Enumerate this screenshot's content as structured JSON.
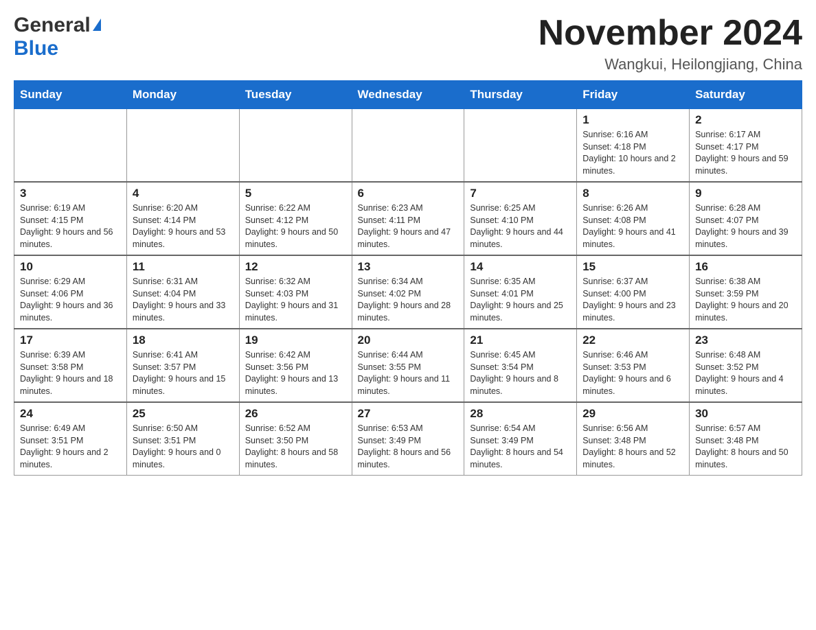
{
  "logo": {
    "general": "General",
    "blue": "Blue",
    "triangle": "▲"
  },
  "header": {
    "title": "November 2024",
    "location": "Wangkui, Heilongjiang, China"
  },
  "weekdays": [
    "Sunday",
    "Monday",
    "Tuesday",
    "Wednesday",
    "Thursday",
    "Friday",
    "Saturday"
  ],
  "weeks": [
    [
      {
        "day": "",
        "info": ""
      },
      {
        "day": "",
        "info": ""
      },
      {
        "day": "",
        "info": ""
      },
      {
        "day": "",
        "info": ""
      },
      {
        "day": "",
        "info": ""
      },
      {
        "day": "1",
        "info": "Sunrise: 6:16 AM\nSunset: 4:18 PM\nDaylight: 10 hours and 2 minutes."
      },
      {
        "day": "2",
        "info": "Sunrise: 6:17 AM\nSunset: 4:17 PM\nDaylight: 9 hours and 59 minutes."
      }
    ],
    [
      {
        "day": "3",
        "info": "Sunrise: 6:19 AM\nSunset: 4:15 PM\nDaylight: 9 hours and 56 minutes."
      },
      {
        "day": "4",
        "info": "Sunrise: 6:20 AM\nSunset: 4:14 PM\nDaylight: 9 hours and 53 minutes."
      },
      {
        "day": "5",
        "info": "Sunrise: 6:22 AM\nSunset: 4:12 PM\nDaylight: 9 hours and 50 minutes."
      },
      {
        "day": "6",
        "info": "Sunrise: 6:23 AM\nSunset: 4:11 PM\nDaylight: 9 hours and 47 minutes."
      },
      {
        "day": "7",
        "info": "Sunrise: 6:25 AM\nSunset: 4:10 PM\nDaylight: 9 hours and 44 minutes."
      },
      {
        "day": "8",
        "info": "Sunrise: 6:26 AM\nSunset: 4:08 PM\nDaylight: 9 hours and 41 minutes."
      },
      {
        "day": "9",
        "info": "Sunrise: 6:28 AM\nSunset: 4:07 PM\nDaylight: 9 hours and 39 minutes."
      }
    ],
    [
      {
        "day": "10",
        "info": "Sunrise: 6:29 AM\nSunset: 4:06 PM\nDaylight: 9 hours and 36 minutes."
      },
      {
        "day": "11",
        "info": "Sunrise: 6:31 AM\nSunset: 4:04 PM\nDaylight: 9 hours and 33 minutes."
      },
      {
        "day": "12",
        "info": "Sunrise: 6:32 AM\nSunset: 4:03 PM\nDaylight: 9 hours and 31 minutes."
      },
      {
        "day": "13",
        "info": "Sunrise: 6:34 AM\nSunset: 4:02 PM\nDaylight: 9 hours and 28 minutes."
      },
      {
        "day": "14",
        "info": "Sunrise: 6:35 AM\nSunset: 4:01 PM\nDaylight: 9 hours and 25 minutes."
      },
      {
        "day": "15",
        "info": "Sunrise: 6:37 AM\nSunset: 4:00 PM\nDaylight: 9 hours and 23 minutes."
      },
      {
        "day": "16",
        "info": "Sunrise: 6:38 AM\nSunset: 3:59 PM\nDaylight: 9 hours and 20 minutes."
      }
    ],
    [
      {
        "day": "17",
        "info": "Sunrise: 6:39 AM\nSunset: 3:58 PM\nDaylight: 9 hours and 18 minutes."
      },
      {
        "day": "18",
        "info": "Sunrise: 6:41 AM\nSunset: 3:57 PM\nDaylight: 9 hours and 15 minutes."
      },
      {
        "day": "19",
        "info": "Sunrise: 6:42 AM\nSunset: 3:56 PM\nDaylight: 9 hours and 13 minutes."
      },
      {
        "day": "20",
        "info": "Sunrise: 6:44 AM\nSunset: 3:55 PM\nDaylight: 9 hours and 11 minutes."
      },
      {
        "day": "21",
        "info": "Sunrise: 6:45 AM\nSunset: 3:54 PM\nDaylight: 9 hours and 8 minutes."
      },
      {
        "day": "22",
        "info": "Sunrise: 6:46 AM\nSunset: 3:53 PM\nDaylight: 9 hours and 6 minutes."
      },
      {
        "day": "23",
        "info": "Sunrise: 6:48 AM\nSunset: 3:52 PM\nDaylight: 9 hours and 4 minutes."
      }
    ],
    [
      {
        "day": "24",
        "info": "Sunrise: 6:49 AM\nSunset: 3:51 PM\nDaylight: 9 hours and 2 minutes."
      },
      {
        "day": "25",
        "info": "Sunrise: 6:50 AM\nSunset: 3:51 PM\nDaylight: 9 hours and 0 minutes."
      },
      {
        "day": "26",
        "info": "Sunrise: 6:52 AM\nSunset: 3:50 PM\nDaylight: 8 hours and 58 minutes."
      },
      {
        "day": "27",
        "info": "Sunrise: 6:53 AM\nSunset: 3:49 PM\nDaylight: 8 hours and 56 minutes."
      },
      {
        "day": "28",
        "info": "Sunrise: 6:54 AM\nSunset: 3:49 PM\nDaylight: 8 hours and 54 minutes."
      },
      {
        "day": "29",
        "info": "Sunrise: 6:56 AM\nSunset: 3:48 PM\nDaylight: 8 hours and 52 minutes."
      },
      {
        "day": "30",
        "info": "Sunrise: 6:57 AM\nSunset: 3:48 PM\nDaylight: 8 hours and 50 minutes."
      }
    ]
  ]
}
